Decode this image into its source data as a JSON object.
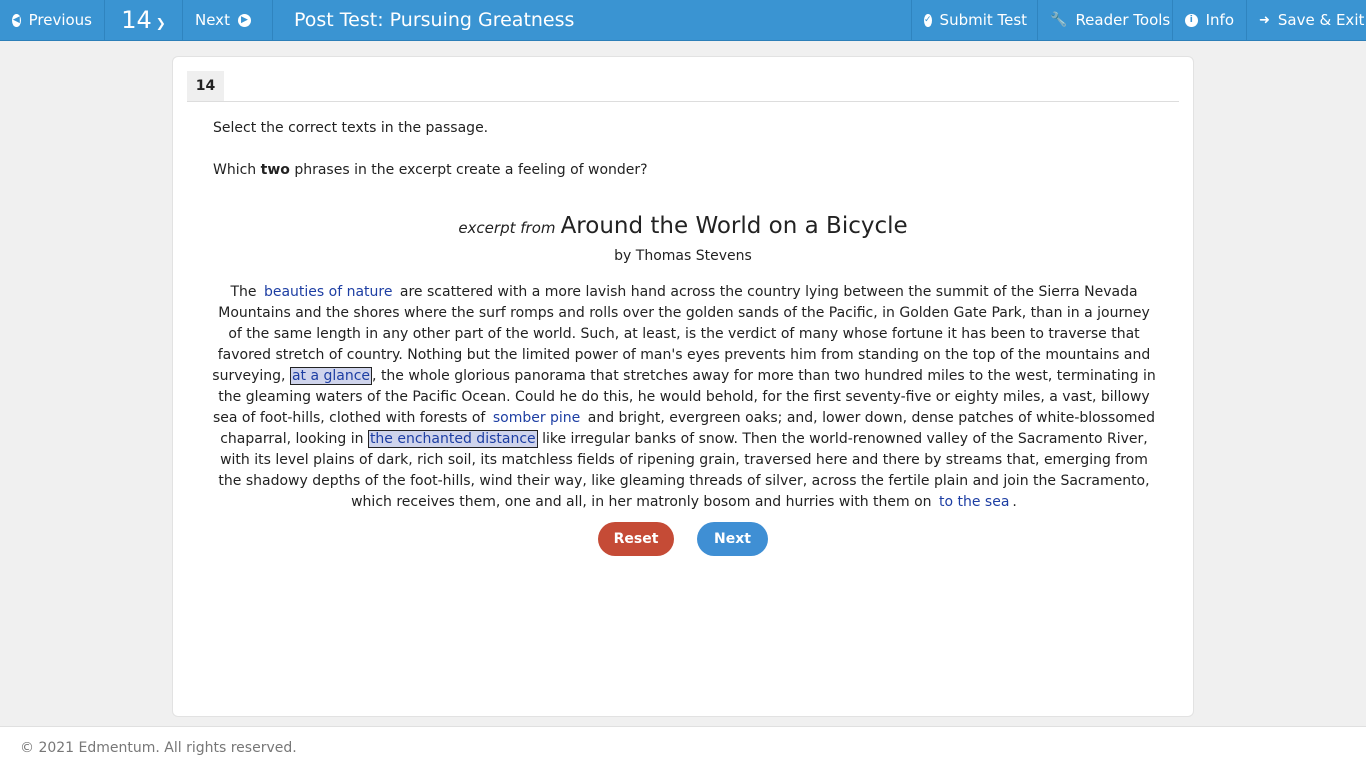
{
  "topbar": {
    "previous_label": "Previous",
    "question_number": "14",
    "next_label": "Next",
    "title": "Post Test: Pursuing Greatness",
    "submit_label": "Submit Test",
    "reader_tools_label": "Reader Tools",
    "info_label": "Info",
    "save_exit_label": "Save & Exit"
  },
  "question": {
    "number": "14",
    "instruction": "Select the correct texts in the passage.",
    "prompt_before": "Which ",
    "prompt_bold": "two",
    "prompt_after": " phrases in the excerpt create a feeling of wonder?"
  },
  "excerpt": {
    "prefix": "excerpt from",
    "title": "Around the World on a Bicycle",
    "author": "by Thomas Stevens"
  },
  "passage": {
    "p1": "The",
    "s1": "beauties of nature",
    "p2": "are scattered with a more lavish hand across the country lying between the summit of the Sierra Nevada Mountains and the shores where the surf romps and rolls over the golden sands of the Pacific, in Golden Gate Park, than in a journey of the same length in any other part of the world. Such, at least, is the verdict of many whose fortune it has been to traverse that favored stretch of country. Nothing but the limited power of man's eyes prevents him from standing on the top of the mountains and surveying,",
    "s2": "at a glance",
    "p3": ", the whole glorious panorama that stretches away for more than two hundred miles to the west, terminating in the gleaming waters of the Pacific Ocean. Could he do this, he would behold, for the first seventy-five or eighty miles, a vast, billowy sea of foot-hills, clothed with forests of",
    "s3": "somber pine",
    "p4": "and bright, evergreen oaks; and, lower down, dense patches of white-blossomed chaparral, looking in",
    "s4": "the enchanted distance",
    "p5": "like irregular banks of snow. Then the world-renowned valley of the Sacramento River, with its level plains of dark, rich soil, its matchless fields of ripening grain, traversed here and there by streams that, emerging from the shadowy depths of the foot-hills, wind their way, like gleaming threads of silver, across the fertile plain and join the Sacramento, which receives them, one and all, in her matronly bosom and hurries with them on",
    "s5": "to the sea",
    "p6": "."
  },
  "selected": [
    "at a glance",
    "the enchanted distance"
  ],
  "buttons": {
    "reset_label": "Reset",
    "next_label": "Next"
  },
  "footer": {
    "copyright": "© 2021 Edmentum. All rights reserved."
  },
  "colors": {
    "topbar": "#3a94d2",
    "selectable_text": "#1d3ea3",
    "reset_button": "#c54b36",
    "next_button": "#3f8fd4"
  }
}
